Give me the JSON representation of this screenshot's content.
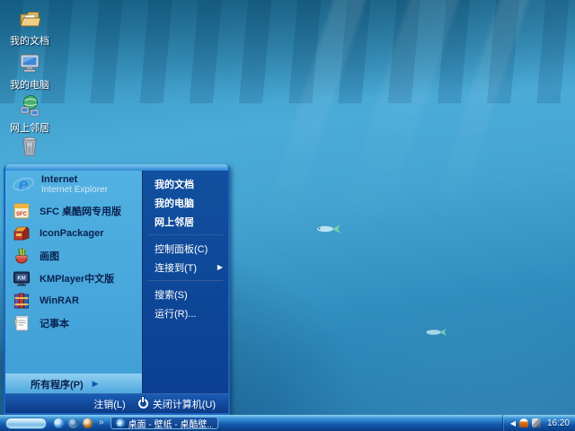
{
  "desktop": {
    "icons": [
      {
        "label": "我的文档"
      },
      {
        "label": "我的电脑"
      },
      {
        "label": "网上邻居"
      },
      {
        "label": ""
      }
    ]
  },
  "start_menu": {
    "pinned": [
      {
        "label": "Internet",
        "sublabel": "Internet Explorer"
      },
      {
        "label": "SFC 桌酷网专用版"
      },
      {
        "label": "IconPackager"
      },
      {
        "label": "画图"
      },
      {
        "label": "KMPlayer中文版"
      },
      {
        "label": "WinRAR"
      },
      {
        "label": "记事本"
      }
    ],
    "places": [
      "我的文档",
      "我的电脑",
      "网上邻居"
    ],
    "system": [
      "控制面板(C)",
      "连接到(T)"
    ],
    "search_run": [
      "搜索(S)",
      "运行(R)..."
    ],
    "all_programs_label": "所有程序(P)",
    "logoff_label": "注销(L)",
    "shutdown_label": "关闭计算机(U)"
  },
  "taskbar": {
    "task_button_label": "桌面 - 壁纸 - 桌酷壁...",
    "clock": "16:20"
  },
  "icons": {
    "submenu_arrow": "▶",
    "all_programs_arrow": "▶",
    "qlaunch_chevron": "»",
    "tray_collapse": "◀",
    "ie_letter": "e"
  },
  "colors": {
    "menu_left_bg": "#46aadf",
    "menu_right_bg": "#0d4196",
    "menu_border": "#1a64c0",
    "taskbar_blue": "#1259ae"
  }
}
